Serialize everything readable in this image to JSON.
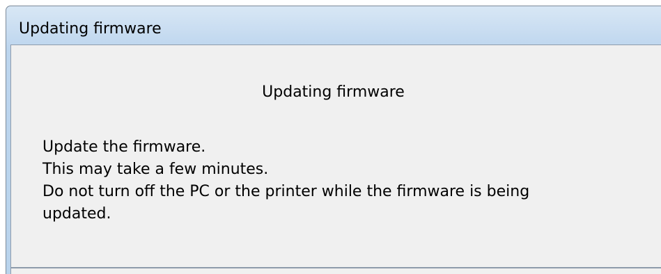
{
  "window": {
    "title": "Updating firmware"
  },
  "dialog": {
    "header": "Updating firmware",
    "message_lines": [
      "Update the firmware.",
      "This may take a few minutes.",
      "Do not turn off the PC or the printer while the firmware is being",
      "updated."
    ]
  },
  "colors": {
    "title_bar": "#c9ddf1",
    "client_background": "#f0f0f0",
    "border": "#8e9bab"
  }
}
